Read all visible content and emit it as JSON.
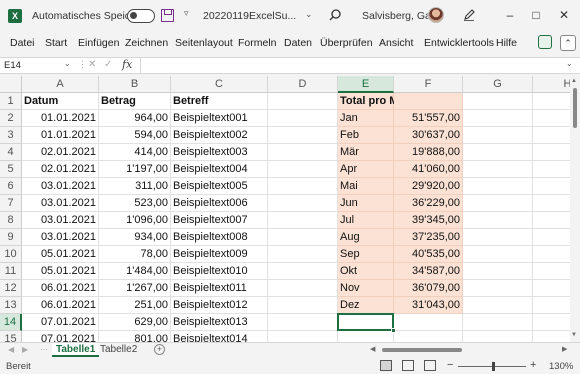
{
  "titlebar": {
    "app_icon": "excel-icon",
    "autosave_label": "Automatisches Speichern",
    "autosave_state": "off",
    "file_title": "20220119ExcelSu...",
    "user_name": "Salvisberg, Gaby",
    "minimize": "–",
    "maximize": "□",
    "close": "✕"
  },
  "menu": {
    "items": [
      "Datei",
      "Start",
      "Einfügen",
      "Zeichnen",
      "Seitenlayout",
      "Formeln",
      "Daten",
      "Überprüfen",
      "Ansicht",
      "Entwicklertools",
      "Hilfe"
    ]
  },
  "formula_bar": {
    "name_box": "E14",
    "fx": "fx",
    "value": ""
  },
  "grid": {
    "columns": [
      "A",
      "B",
      "C",
      "D",
      "E",
      "F",
      "G",
      "H"
    ],
    "rows": [
      "1",
      "2",
      "3",
      "4",
      "5",
      "6",
      "7",
      "8",
      "9",
      "10",
      "11",
      "12",
      "13",
      "14",
      "15"
    ],
    "selected_cell": "E14",
    "accent_color": "#1d6f42",
    "highlight_color": "#fbe2d5",
    "header": {
      "datum": "Datum",
      "betrag": "Betrag",
      "betreff": "Betreff",
      "total": "Total pro Monat"
    },
    "data_rows": [
      {
        "datum": "01.01.2021",
        "betrag": "964,00",
        "betreff": "Beispieltext001"
      },
      {
        "datum": "01.01.2021",
        "betrag": "594,00",
        "betreff": "Beispieltext002"
      },
      {
        "datum": "02.01.2021",
        "betrag": "414,00",
        "betreff": "Beispieltext003"
      },
      {
        "datum": "02.01.2021",
        "betrag": "1'197,00",
        "betreff": "Beispieltext004"
      },
      {
        "datum": "03.01.2021",
        "betrag": "311,00",
        "betreff": "Beispieltext005"
      },
      {
        "datum": "03.01.2021",
        "betrag": "523,00",
        "betreff": "Beispieltext006"
      },
      {
        "datum": "03.01.2021",
        "betrag": "1'096,00",
        "betreff": "Beispieltext007"
      },
      {
        "datum": "03.01.2021",
        "betrag": "934,00",
        "betreff": "Beispieltext008"
      },
      {
        "datum": "05.01.2021",
        "betrag": "78,00",
        "betreff": "Beispieltext009"
      },
      {
        "datum": "05.01.2021",
        "betrag": "1'484,00",
        "betreff": "Beispieltext010"
      },
      {
        "datum": "06.01.2021",
        "betrag": "1'267,00",
        "betreff": "Beispieltext011"
      },
      {
        "datum": "06.01.2021",
        "betrag": "251,00",
        "betreff": "Beispieltext012"
      },
      {
        "datum": "07.01.2021",
        "betrag": "629,00",
        "betreff": "Beispieltext013"
      },
      {
        "datum": "07.01.2021",
        "betrag": "801,00",
        "betreff": "Beispieltext014"
      }
    ],
    "monthly": [
      {
        "month": "Jan",
        "total": "51'557,00"
      },
      {
        "month": "Feb",
        "total": "30'637,00"
      },
      {
        "month": "Mär",
        "total": "19'888,00"
      },
      {
        "month": "Apr",
        "total": "41'060,00"
      },
      {
        "month": "Mai",
        "total": "29'920,00"
      },
      {
        "month": "Jun",
        "total": "36'229,00"
      },
      {
        "month": "Jul",
        "total": "39'345,00"
      },
      {
        "month": "Aug",
        "total": "37'235,00"
      },
      {
        "month": "Sep",
        "total": "40'535,00"
      },
      {
        "month": "Okt",
        "total": "34'587,00"
      },
      {
        "month": "Nov",
        "total": "36'079,00"
      },
      {
        "month": "Dez",
        "total": "31'043,00"
      }
    ]
  },
  "sheets": {
    "tabs": [
      "Tabelle1",
      "Tabelle2"
    ],
    "active": "Tabelle1",
    "add": "+"
  },
  "statusbar": {
    "status": "Bereit",
    "zoom_minus": "−",
    "zoom_plus": "+",
    "zoom_level": "130%"
  }
}
